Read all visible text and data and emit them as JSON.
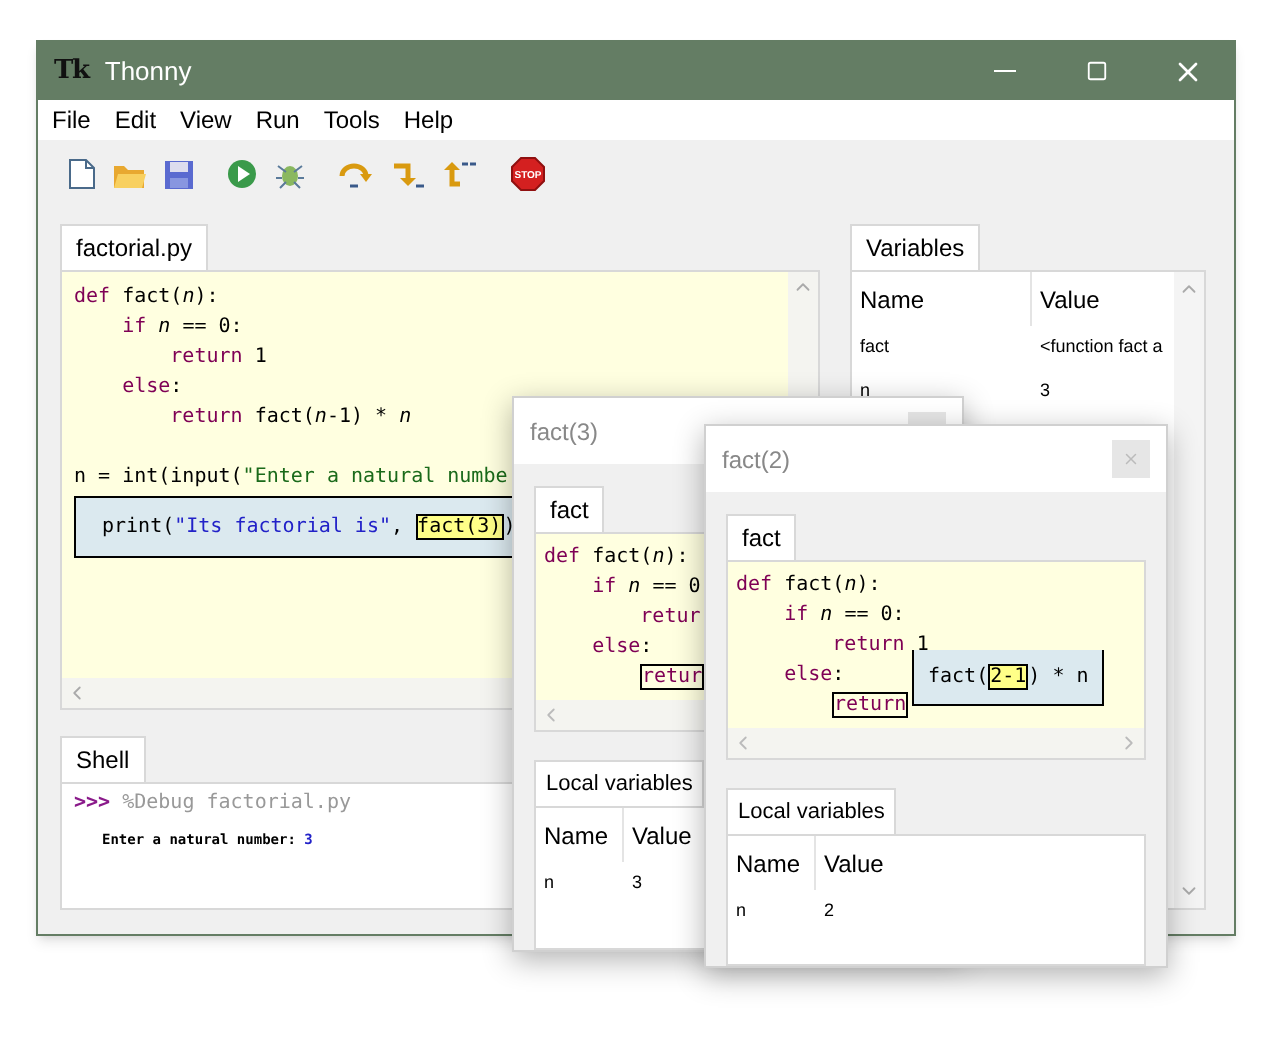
{
  "window": {
    "title": "Thonny",
    "logo": "Tk"
  },
  "menu": [
    "File",
    "Edit",
    "View",
    "Run",
    "Tools",
    "Help"
  ],
  "toolbar": [
    [
      {
        "kind": "new"
      },
      {
        "kind": "open"
      },
      {
        "kind": "save"
      }
    ],
    [
      {
        "kind": "run"
      },
      {
        "kind": "debug"
      }
    ],
    [
      {
        "kind": "step_over"
      },
      {
        "kind": "step_into"
      },
      {
        "kind": "step_out"
      }
    ],
    [
      {
        "kind": "stop",
        "label": "STOP"
      }
    ]
  ],
  "editor": {
    "tab": "factorial.py",
    "lines": [
      {
        "kind": "code",
        "segs": [
          {
            "kind": "kw",
            "t": "def"
          },
          {
            "kind": "plain",
            "t": " fact("
          },
          {
            "kind": "param",
            "t": "n"
          },
          {
            "kind": "plain",
            "t": "):"
          }
        ]
      },
      {
        "kind": "code",
        "segs": [
          {
            "kind": "kw",
            "t": "    if "
          },
          {
            "kind": "param",
            "t": "n"
          },
          {
            "kind": "plain",
            "t": " == 0:"
          }
        ]
      },
      {
        "kind": "code",
        "segs": [
          {
            "kind": "kw",
            "t": "        return"
          },
          {
            "kind": "plain",
            "t": " 1"
          }
        ]
      },
      {
        "kind": "code",
        "segs": [
          {
            "kind": "kw",
            "t": "    else"
          },
          {
            "kind": "plain",
            "t": ":"
          }
        ]
      },
      {
        "kind": "code",
        "segs": [
          {
            "kind": "kw",
            "t": "        return"
          },
          {
            "kind": "plain",
            "t": " fact("
          },
          {
            "kind": "param",
            "t": "n"
          },
          {
            "kind": "plain",
            "t": "-1) * "
          },
          {
            "kind": "param",
            "t": "n"
          }
        ]
      },
      {
        "kind": "blank"
      },
      {
        "kind": "code",
        "segs": [
          {
            "kind": "plain",
            "t": "n = int(input("
          },
          {
            "kind": "str",
            "t": "\"Enter a natural numbe"
          }
        ]
      },
      {
        "kind": "tooltip",
        "segs": [
          {
            "kind": "plain",
            "t": "print("
          },
          {
            "kind": "str_tip",
            "t": "\"Its factorial is\""
          },
          {
            "kind": "plain",
            "t": ", "
          },
          {
            "kind": "hl",
            "t": "fact(3)"
          },
          {
            "kind": "plain",
            "t": ")"
          }
        ]
      }
    ]
  },
  "variables": {
    "tab": "Variables",
    "columns": [
      "Name",
      "Value"
    ],
    "rows": [
      {
        "name": "fact",
        "value": "<function fact a"
      },
      {
        "name": "n",
        "value": "3"
      }
    ]
  },
  "shell": {
    "tab": "Shell",
    "prompt": ">>>",
    "command": "%Debug factorial.py",
    "output": [
      {
        "kind": "out",
        "t": "Enter a natural number: "
      },
      {
        "kind": "input",
        "t": "3"
      }
    ]
  },
  "frames": [
    {
      "title": "fact(3)",
      "tab": "fact",
      "lines": [
        {
          "kind": "code",
          "segs": [
            {
              "kind": "kw",
              "t": "def"
            },
            {
              "kind": "plain",
              "t": " fact("
            },
            {
              "kind": "param",
              "t": "n"
            },
            {
              "kind": "plain",
              "t": "):"
            }
          ]
        },
        {
          "kind": "code",
          "segs": [
            {
              "kind": "kw",
              "t": "    if "
            },
            {
              "kind": "param",
              "t": "n"
            },
            {
              "kind": "plain",
              "t": " == 0"
            }
          ]
        },
        {
          "kind": "code",
          "segs": [
            {
              "kind": "kw",
              "t": "        retur"
            }
          ]
        },
        {
          "kind": "code",
          "segs": [
            {
              "kind": "kw",
              "t": "    else"
            },
            {
              "kind": "plain",
              "t": ":"
            }
          ]
        },
        {
          "kind": "code",
          "segs": [
            {
              "kind": "kwbox",
              "t": "retur"
            }
          ]
        }
      ],
      "locals_tab": "Local variables",
      "columns": [
        "Name",
        "Value"
      ],
      "rows": [
        {
          "name": "n",
          "value": "3"
        }
      ]
    },
    {
      "title": "fact(2)",
      "tab": "fact",
      "lines": [
        {
          "kind": "code",
          "segs": [
            {
              "kind": "kw",
              "t": "def"
            },
            {
              "kind": "plain",
              "t": " fact("
            },
            {
              "kind": "param",
              "t": "n"
            },
            {
              "kind": "plain",
              "t": "):"
            }
          ]
        },
        {
          "kind": "code",
          "segs": [
            {
              "kind": "kw",
              "t": "    if "
            },
            {
              "kind": "param",
              "t": "n"
            },
            {
              "kind": "plain",
              "t": " == 0:"
            }
          ]
        },
        {
          "kind": "code",
          "segs": [
            {
              "kind": "kw",
              "t": "        return"
            },
            {
              "kind": "plain",
              "t": " 1"
            }
          ]
        },
        {
          "kind": "code",
          "segs": [
            {
              "kind": "kw",
              "t": "    else"
            },
            {
              "kind": "plain",
              "t": ":"
            }
          ]
        },
        {
          "kind": "code",
          "segs": [
            {
              "kind": "kwbox",
              "t": "return"
            }
          ]
        }
      ],
      "tooltip": [
        {
          "kind": "plain",
          "t": "fact("
        },
        {
          "kind": "hl",
          "t": "2-1"
        },
        {
          "kind": "plain",
          "t": ") * n"
        }
      ],
      "locals_tab": "Local variables",
      "columns": [
        "Name",
        "Value"
      ],
      "rows": [
        {
          "name": "n",
          "value": "2"
        }
      ]
    }
  ]
}
